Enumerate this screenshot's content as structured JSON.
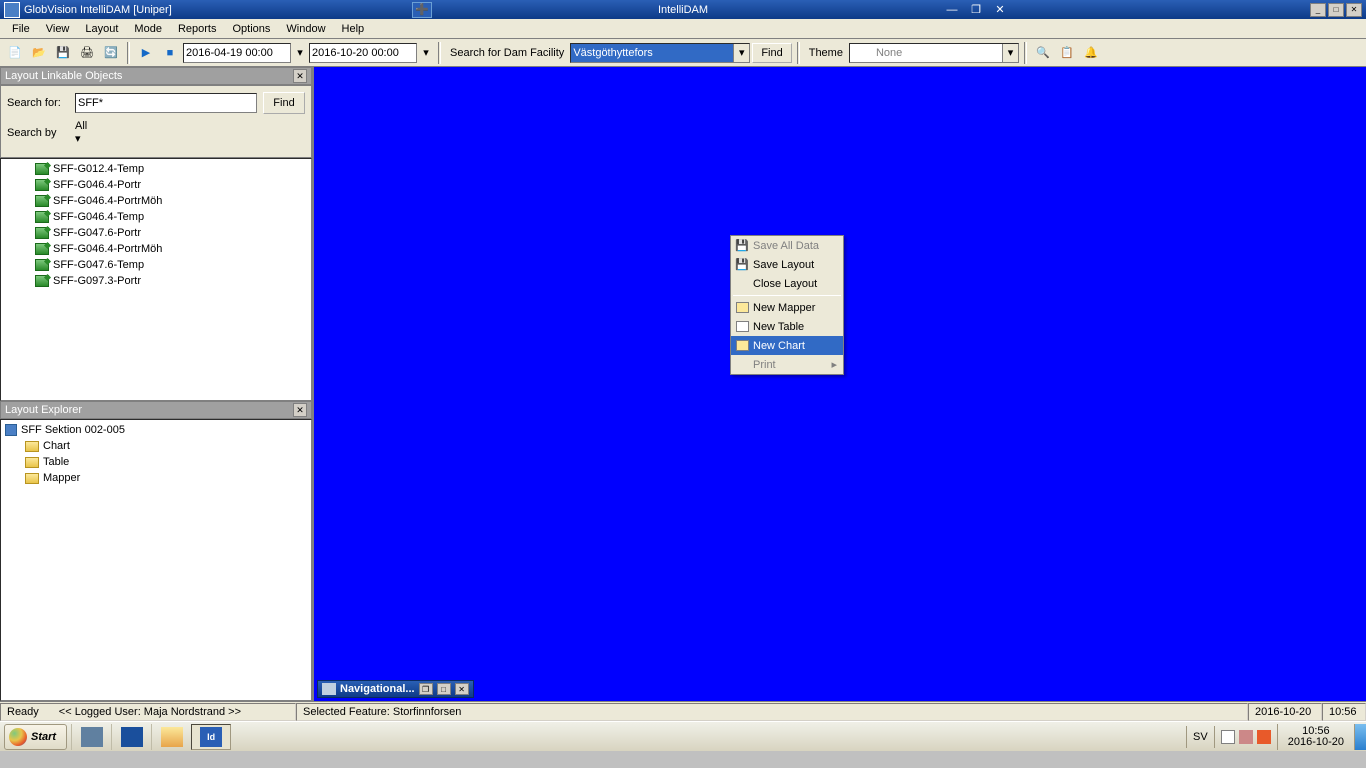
{
  "titlebar": {
    "app_title": "GlobVision IntelliDAM [Uniper]",
    "center_title": "IntelliDAM"
  },
  "menubar": {
    "items": [
      "File",
      "View",
      "Layout",
      "Mode",
      "Reports",
      "Options",
      "Window",
      "Help"
    ]
  },
  "toolbar": {
    "date_from": "2016-04-19 00:00",
    "date_to": "2016-10-20 00:00",
    "search_label": "Search for Dam Facility",
    "facility_value": "Västgöthyttefors",
    "find_btn": "Find",
    "theme_label": "Theme",
    "theme_value": "None"
  },
  "linkable": {
    "header": "Layout Linkable Objects",
    "search_for_label": "Search for:",
    "search_for_value": "SFF*",
    "find_btn": "Find",
    "search_by_label": "Search by",
    "search_by_value": "All",
    "items": [
      "SFF-G012.4-Temp",
      "SFF-G046.4-Portr",
      "SFF-G046.4-PortrMöh",
      "SFF-G046.4-Temp",
      "SFF-G047.6-Portr",
      "SFF-G046.4-PortrMöh",
      "SFF-G047.6-Temp",
      "SFF-G097.3-Portr"
    ]
  },
  "layout_explorer": {
    "header": "Layout Explorer",
    "root": "SFF Sektion 002-005",
    "children": [
      "Chart",
      "Table",
      "Mapper"
    ]
  },
  "context_menu": {
    "save_all": "Save All Data",
    "save_layout": "Save Layout",
    "close_layout": "Close Layout",
    "new_mapper": "New Mapper",
    "new_table": "New Table",
    "new_chart": "New Chart",
    "print": "Print"
  },
  "nav_mini": {
    "label": "Navigational..."
  },
  "statusbar": {
    "ready": "Ready",
    "logged_user": "<< Logged User: Maja Nordstrand >>",
    "selected_feature": "Selected Feature: Storfinnforsen",
    "date": "2016-10-20",
    "time": "10:56"
  },
  "taskbar": {
    "start": "Start",
    "lang": "SV",
    "clock_time": "10:56",
    "clock_date": "2016-10-20"
  }
}
